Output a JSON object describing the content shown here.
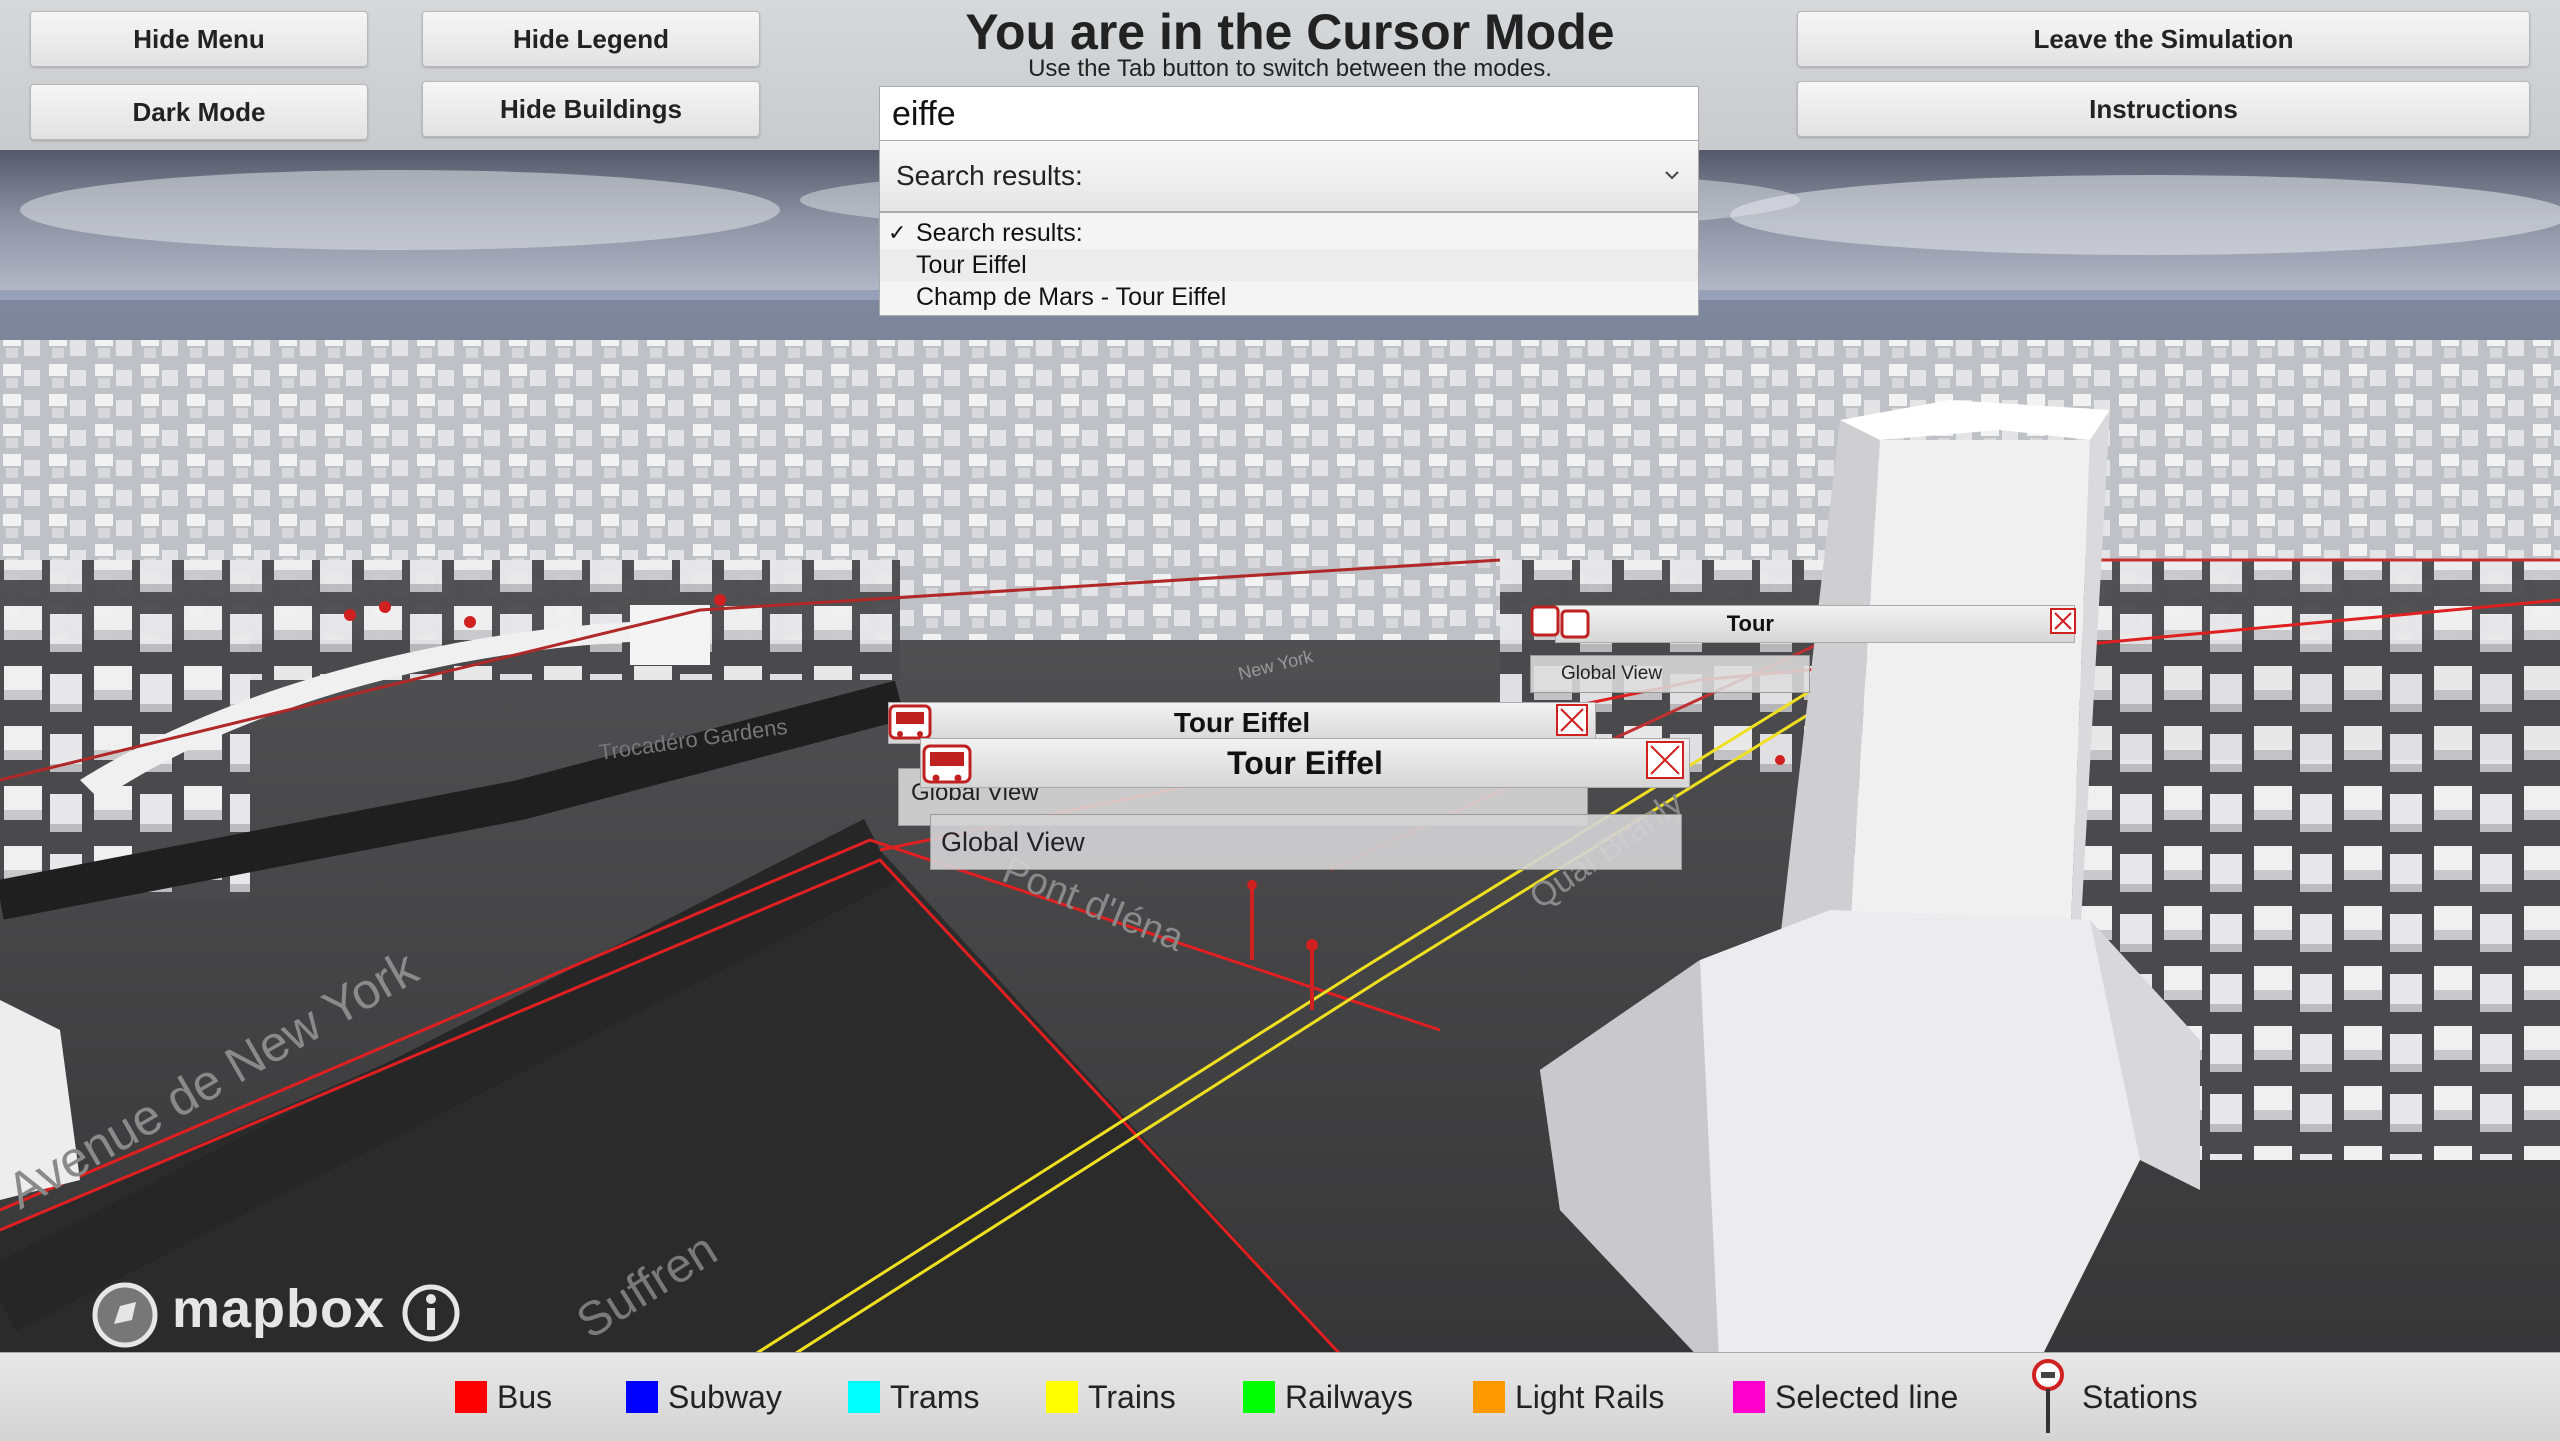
{
  "header": {
    "title": "You are in the Cursor Mode",
    "subtitle": "Use the Tab button to switch between the modes."
  },
  "buttons": {
    "hide_menu": "Hide Menu",
    "dark_mode": "Dark Mode",
    "hide_legend": "Hide Legend",
    "hide_buildings": "Hide Buildings",
    "leave_simulation": "Leave the Simulation",
    "instructions": "Instructions"
  },
  "search": {
    "value": "eiffe",
    "selected_label": "Search results:",
    "results": [
      {
        "label": "Search results:",
        "selected": true
      },
      {
        "label": "Tour Eiffel",
        "selected": false
      },
      {
        "label": "Champ de Mars - Tour Eiffel",
        "selected": false
      }
    ]
  },
  "station_popups": [
    {
      "title": "Tour Eiffel",
      "view_label": "Global View"
    },
    {
      "title": "Tour Eiffel",
      "view_label": "Global View"
    },
    {
      "title": "Tour",
      "view_label": "Global View"
    }
  ],
  "map_labels": {
    "trocadero": "Trocadéro Gardens",
    "new_york": "Avenue de New York",
    "iena": "Pont d'Iéna",
    "branly": "Quai Branly",
    "suffren": "Suffren",
    "newyork_small": "New York"
  },
  "attribution": {
    "brand": "mapbox",
    "info_icon": "info-icon"
  },
  "legend": [
    {
      "label": "Bus",
      "color": "#ff0000"
    },
    {
      "label": "Subway",
      "color": "#0000ff"
    },
    {
      "label": "Trams",
      "color": "#00ffff"
    },
    {
      "label": "Trains",
      "color": "#ffff00"
    },
    {
      "label": "Railways",
      "color": "#00ff00"
    },
    {
      "label": "Light Rails",
      "color": "#ff9900"
    },
    {
      "label": "Selected line",
      "color": "#ff00cc"
    },
    {
      "label": "Stations",
      "icon": "station-pin-icon"
    }
  ],
  "colors": {
    "ground": "#3c3c3c",
    "building": "#e9e9e9",
    "bus_line": "#e02020",
    "train_line": "#f0e020"
  }
}
